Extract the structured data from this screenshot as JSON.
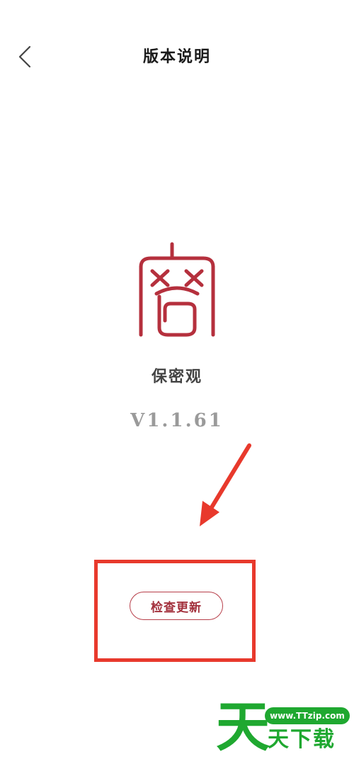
{
  "header": {
    "back_icon": "chevron-left-icon",
    "title": "版本说明"
  },
  "app": {
    "logo_glyph": "密",
    "name": "保密观",
    "version": "V1.1.61"
  },
  "actions": {
    "check_update_label": "检查更新"
  },
  "annotation": {
    "arrow_color": "#e8392c",
    "highlight_color": "#e8392c"
  },
  "watermark": {
    "big_char": "天",
    "url": "www.TTzip.com",
    "text": "天下载"
  },
  "colors": {
    "brand_red": "#b73e49",
    "watermark_green": "#1fa830"
  }
}
